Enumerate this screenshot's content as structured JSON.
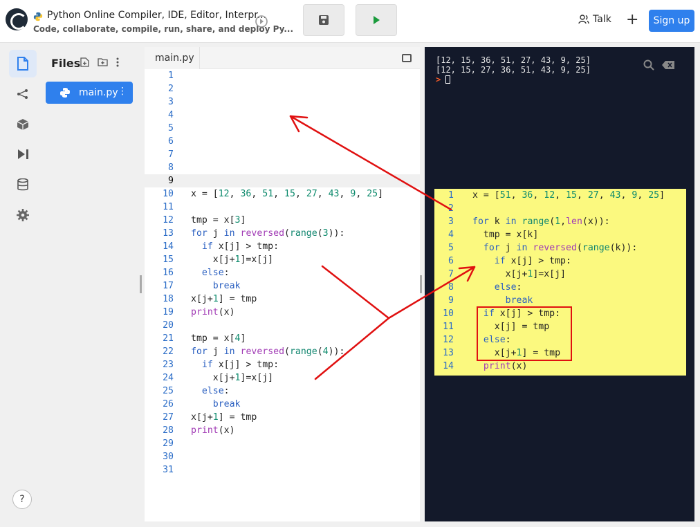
{
  "header": {
    "title": "Python Online Compiler, IDE, Editor, Interpr...",
    "subtitle": "Code, collaborate, compile, run, share, and deploy Py...",
    "talk_label": "Talk",
    "signup_label": "Sign up"
  },
  "files_panel": {
    "title": "Files",
    "file_name": "main.py"
  },
  "editor": {
    "tab_label": "main.py",
    "active_line": 9,
    "line_numbers": [
      "1",
      "2",
      "3",
      "4",
      "5",
      "6",
      "7",
      "8",
      "9",
      "10",
      "11",
      "12",
      "13",
      "14",
      "15",
      "16",
      "17",
      "18",
      "19",
      "20",
      "21",
      "22",
      "23",
      "24",
      "25",
      "26",
      "27",
      "28",
      "29",
      "30",
      "31"
    ]
  },
  "terminal": {
    "line1": "[12, 15, 36, 51, 27, 43, 9, 25]",
    "line2": "[12, 15, 27, 36, 51, 43, 9, 25]",
    "prompt": ">"
  },
  "overlay": {
    "line_numbers": [
      "1",
      "2",
      "3",
      "4",
      "5",
      "6",
      "7",
      "8",
      "9",
      "10",
      "11",
      "12",
      "13",
      "14"
    ]
  },
  "help_label": "?",
  "colors": {
    "accent": "#2f80ed",
    "terminal_bg": "#13192a",
    "overlay_bg": "#fbf97f",
    "annotation": "#e01010"
  },
  "icons": {
    "sidebar": [
      "files-icon",
      "share-icon",
      "packages-icon",
      "run-icon",
      "database-icon",
      "settings-icon"
    ]
  }
}
